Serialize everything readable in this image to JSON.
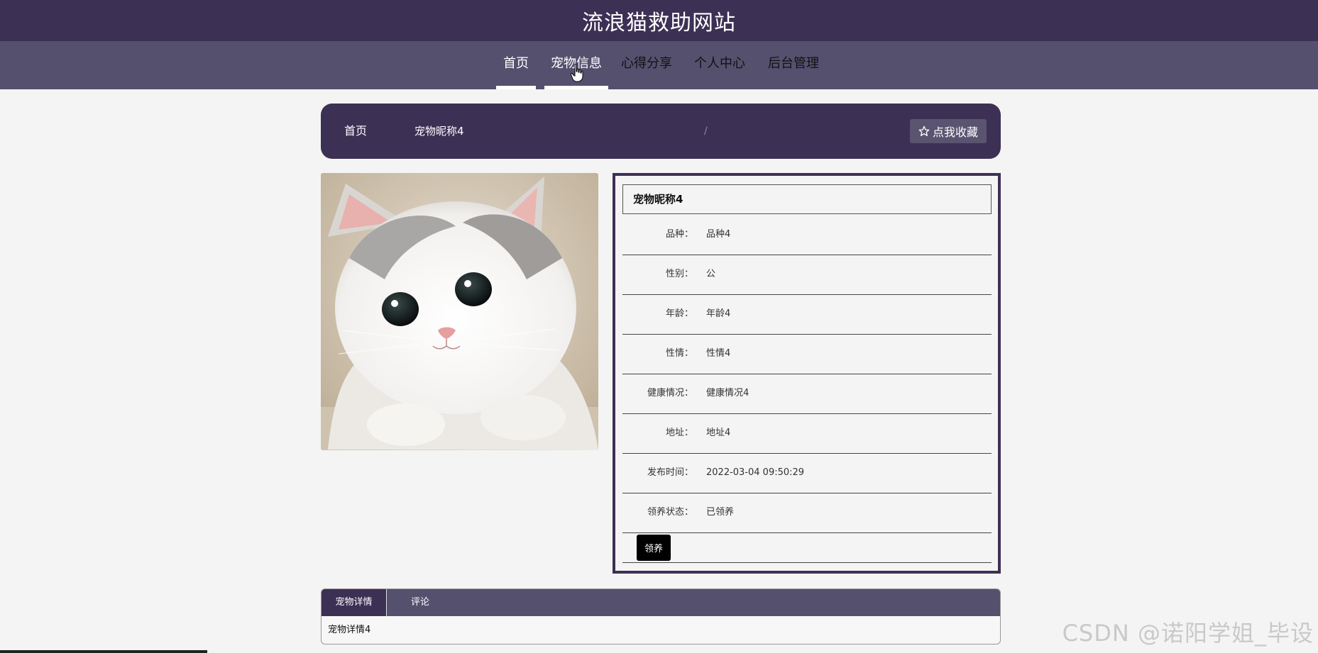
{
  "header": {
    "title": "流浪猫救助网站"
  },
  "nav": {
    "items": [
      {
        "label": "首页"
      },
      {
        "label": "宠物信息"
      },
      {
        "label": "心得分享"
      },
      {
        "label": "个人中心"
      },
      {
        "label": "后台管理"
      }
    ]
  },
  "breadcrumb": {
    "home": "首页",
    "separator": "/",
    "current": "宠物昵称4",
    "favorite_label": "点我收藏"
  },
  "pet": {
    "name": "宠物昵称4",
    "fields": [
      {
        "label": "品种：",
        "value": "品种4"
      },
      {
        "label": "性别：",
        "value": "公"
      },
      {
        "label": "年龄：",
        "value": "年龄4"
      },
      {
        "label": "性情：",
        "value": "性情4"
      },
      {
        "label": "健康情况：",
        "value": "健康情况4"
      },
      {
        "label": "地址：",
        "value": "地址4"
      },
      {
        "label": "发布时间：",
        "value": "2022-03-04 09:50:29"
      },
      {
        "label": "领养状态：",
        "value": "已领养"
      }
    ],
    "adopt_label": "领养"
  },
  "tabs": {
    "items": [
      {
        "label": "宠物详情"
      },
      {
        "label": "评论"
      }
    ],
    "content": "宠物详情4"
  },
  "watermark": "CSDN @诺阳学姐_毕设",
  "colors": {
    "primary": "#3d3055",
    "secondary": "#56506f"
  }
}
